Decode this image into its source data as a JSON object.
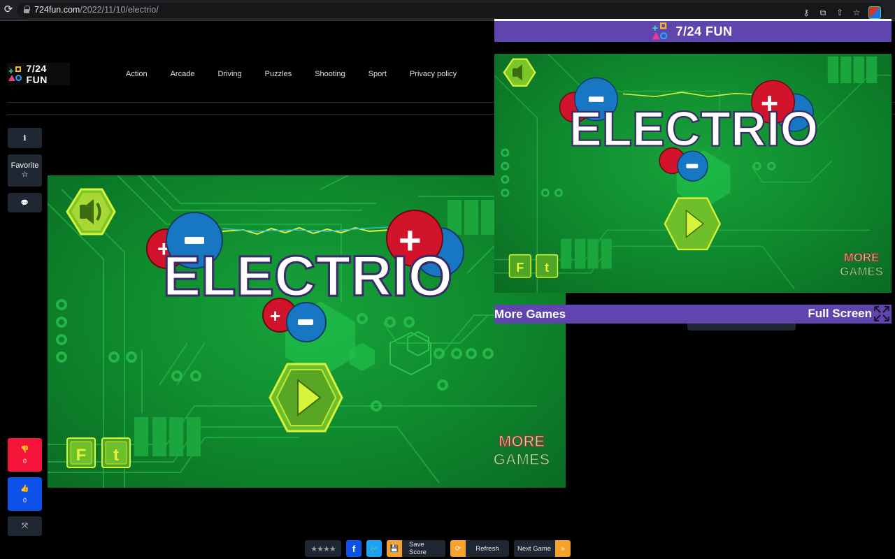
{
  "browser": {
    "url_host": "724fun.com",
    "url_path": "/2022/11/10/electrio/",
    "icons": [
      "reload-icon",
      "lock-icon",
      "key-icon",
      "translate-icon",
      "share-icon",
      "bookmark-star-icon",
      "extension-icon"
    ]
  },
  "site": {
    "logo_text": "7/24 FUN",
    "nav": [
      "Action",
      "Arcade",
      "Driving",
      "Puzzles",
      "Shooting",
      "Sport",
      "Privacy policy"
    ]
  },
  "sidebar": {
    "info_icon": "ℹ",
    "favorite_label": "Favorite",
    "favorite_icon": "☆",
    "comment_icon": "💬",
    "dislike_icon": "👎",
    "dislike_count": "0",
    "like_icon": "👍",
    "like_count": "0",
    "expand_icon": "⤧"
  },
  "game": {
    "title": "ELECTRIO",
    "more_games_line1": "MORE",
    "more_games_line2": "GAMES",
    "facebook_btn": "F",
    "twitter_btn": "t"
  },
  "mini_player": {
    "header_title": "7/24 FUN",
    "more_games_label": "More Games",
    "full_screen_label": "Full Screen"
  },
  "bottom_bar": {
    "stars": "★★★★",
    "facebook": "f",
    "twitter": "🐦",
    "save_score_label": "Save Score",
    "save_icon": "💾",
    "refresh_label": "Refresh",
    "refresh_icon": "⟳",
    "next_game_label": "Next Game",
    "next_icon": "»"
  },
  "colors": {
    "dislike": "#f5153b",
    "like": "#0d52e8",
    "accent_orange": "#f7a22a",
    "mini_player_purple": "#5f45ad",
    "game_green": "#0f8a2e"
  }
}
